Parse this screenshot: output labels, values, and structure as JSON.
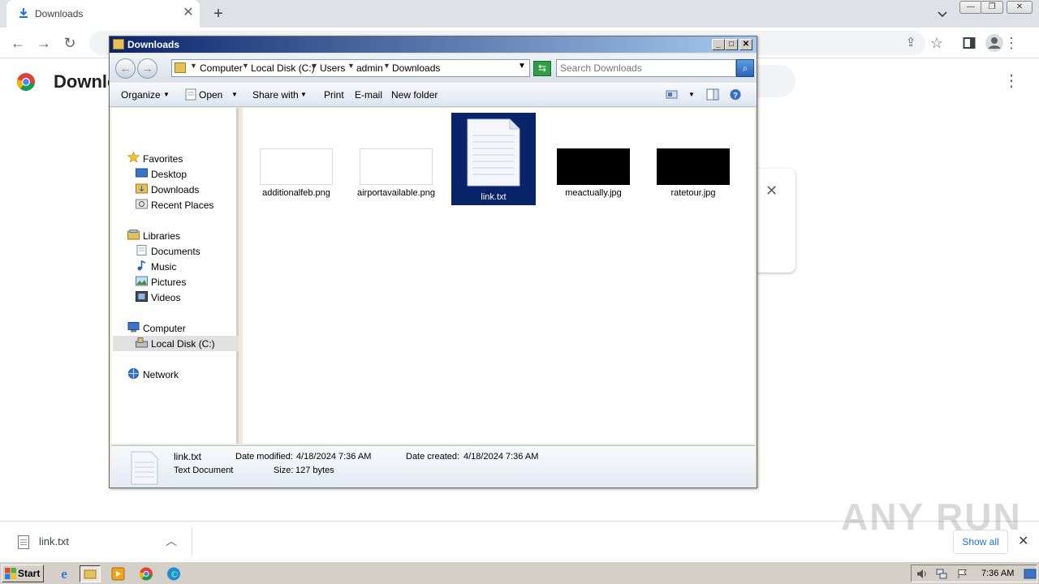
{
  "chrome": {
    "tab_title": "Downloads",
    "page_title": "Downlo",
    "download_item": "link.txt",
    "show_all": "Show all"
  },
  "explorer": {
    "title": "Downloads",
    "breadcrumb": [
      "Computer",
      "Local Disk (C:)",
      "Users",
      "admin",
      "Downloads"
    ],
    "search_placeholder": "Search Downloads",
    "commands": {
      "organize": "Organize",
      "open": "Open",
      "share_with": "Share with",
      "print": "Print",
      "email": "E-mail",
      "new_folder": "New folder"
    },
    "nav": {
      "favorites": "Favorites",
      "desktop": "Desktop",
      "downloads": "Downloads",
      "recent_places": "Recent Places",
      "libraries": "Libraries",
      "documents": "Documents",
      "music": "Music",
      "pictures": "Pictures",
      "videos": "Videos",
      "computer": "Computer",
      "local_disk": "Local Disk (C:)",
      "network": "Network"
    },
    "files": [
      {
        "name": "additionalfeb.png",
        "thumb": "white"
      },
      {
        "name": "airportavailable.png",
        "thumb": "white"
      },
      {
        "name": "link.txt",
        "thumb": "text",
        "selected": true
      },
      {
        "name": "meactually.jpg",
        "thumb": "black"
      },
      {
        "name": "ratetour.jpg",
        "thumb": "black"
      }
    ],
    "details": {
      "file_name": "link.txt",
      "file_type": "Text Document",
      "date_modified_label": "Date modified:",
      "date_modified": "4/18/2024 7:36 AM",
      "size_label": "Size:",
      "size": "127 bytes",
      "date_created_label": "Date created:",
      "date_created": "4/18/2024 7:36 AM"
    }
  },
  "taskbar": {
    "start_label": "Start",
    "clock": "7:36 AM"
  },
  "watermark": "ANY RUN",
  "colors": {
    "titlebar_start": "#0a246a",
    "titlebar_end": "#a6caf0",
    "selection": "#0a246a",
    "chrome_link": "#1a73e8"
  }
}
